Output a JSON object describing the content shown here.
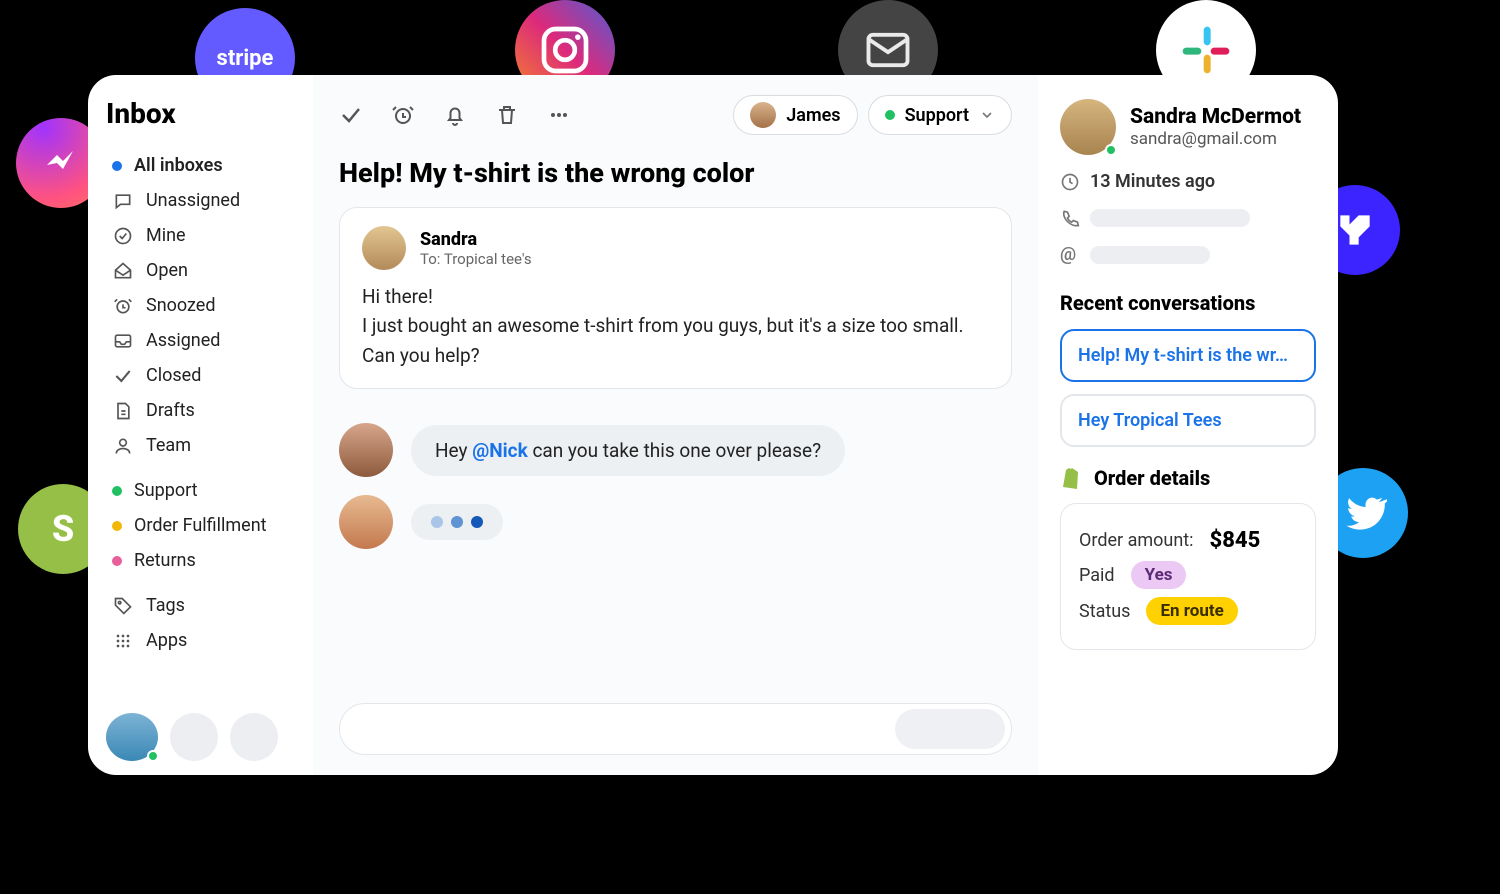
{
  "sidebar": {
    "title": "Inbox",
    "items": [
      {
        "label": "All inboxes",
        "dot": "#1a73e8",
        "active": true
      },
      {
        "label": "Unassigned",
        "icon": "tag-outline"
      },
      {
        "label": "Mine",
        "icon": "check-circle"
      },
      {
        "label": "Open",
        "icon": "inbox-open"
      },
      {
        "label": "Snoozed",
        "icon": "alarm"
      },
      {
        "label": "Assigned",
        "icon": "tray"
      },
      {
        "label": "Closed",
        "icon": "check"
      },
      {
        "label": "Drafts",
        "icon": "draft"
      },
      {
        "label": "Team",
        "icon": "person"
      }
    ],
    "groups": [
      {
        "label": "Support",
        "dot": "#20c063"
      },
      {
        "label": "Order Fulfillment",
        "dot": "#f2b705"
      },
      {
        "label": "Returns",
        "dot": "#e85f9a"
      }
    ],
    "footer": [
      {
        "label": "Tags",
        "icon": "tag"
      },
      {
        "label": "Apps",
        "icon": "grid"
      }
    ]
  },
  "assignee": "James",
  "team_pill": "Support",
  "conversation": {
    "title": "Help! My t-shirt is the wrong color",
    "from_name": "Sandra",
    "to_line": "To: Tropical tee's",
    "body_line1": "Hi there!",
    "body_line2": "I just bought an awesome t-shirt from you guys, but it's a size too small. Can you help?",
    "note_prefix": "Hey ",
    "note_mention": "@Nick",
    "note_suffix": " can you take this one over please?"
  },
  "customer": {
    "name": "Sandra McDermot",
    "email": "sandra@gmail.com",
    "last_seen": "13 Minutes ago"
  },
  "recent": {
    "heading": "Recent conversations",
    "items": [
      "Help! My t-shirt is the wr…",
      "Hey Tropical Tees"
    ]
  },
  "order": {
    "heading": "Order details",
    "amount_label": "Order amount:",
    "amount_value": "$845",
    "paid_label": "Paid",
    "paid_value": "Yes",
    "status_label": "Status",
    "status_value": "En route"
  },
  "integrations": {
    "stripe": "stripe",
    "instagram": "instagram",
    "email": "email",
    "slack": "slack",
    "messenger": "messenger",
    "shopify": "shopify",
    "novaly": "novaly",
    "twitter": "twitter"
  }
}
